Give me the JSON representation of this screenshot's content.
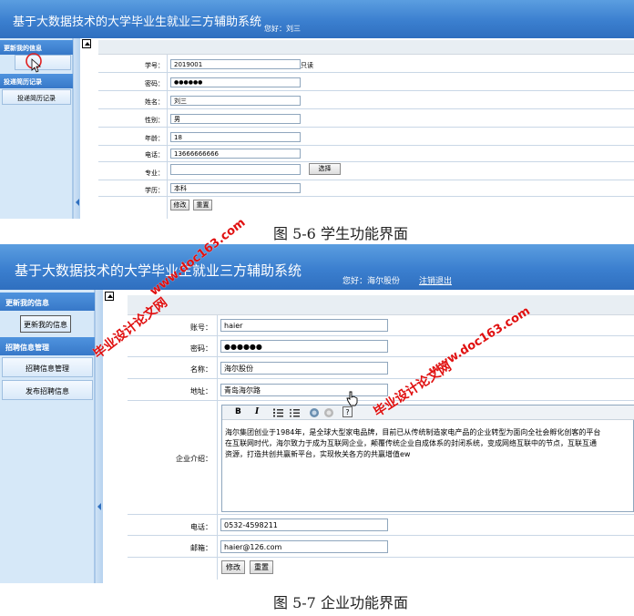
{
  "student": {
    "title": "基于大数据技术的大学毕业生就业三方辅助系统",
    "greeting": "您好：刘三",
    "sidebar": {
      "section1": "更新我的信息",
      "section2": "投递简历记录",
      "item2": "投递简历记录"
    },
    "form": {
      "rows": [
        {
          "label": "学号：",
          "value": "2019001",
          "note": "只读"
        },
        {
          "label": "密码：",
          "value": "●●●●●●"
        },
        {
          "label": "姓名：",
          "value": "刘三"
        },
        {
          "label": "性别：",
          "value": "男"
        },
        {
          "label": "年龄：",
          "value": "18"
        },
        {
          "label": "电话：",
          "value": "13666666666"
        },
        {
          "label": "专业：",
          "value": "",
          "button": "选择"
        },
        {
          "label": "学历：",
          "value": "本科"
        }
      ],
      "submit": "修改",
      "reset": "重置"
    },
    "caption": "图 5-6 学生功能界面"
  },
  "company": {
    "title": "基于大数据技术的大学毕业生就业三方辅助系统",
    "greeting": "您好：海尔股份",
    "logout": "注销退出",
    "sidebar": {
      "section1": "更新我的信息",
      "item1": "更新我的信息",
      "section2": "招聘信息管理",
      "item2": "招聘信息管理",
      "item3": "发布招聘信息"
    },
    "form": {
      "account_label": "账号：",
      "account": "haier",
      "password_label": "密码：",
      "password": "●●●●●●",
      "name_label": "名称：",
      "name": "海尔股份",
      "address_label": "地址：",
      "address": "青岛海尔路",
      "intro_label": "企业介绍：",
      "intro_line1": "海尔集团创业于1984年，是全球大型家电品牌，目前已从传统制造家电产品的企业转型为面向全社会孵化创客的平台",
      "intro_line2": "在互联网时代，海尔致力于成为互联网企业，颠覆传统企业自成体系的封闭系统，变成网络互联中的节点，互联互通",
      "intro_line3": "资源，打造共创共赢新平台，实现攸关各方的共赢增值ew",
      "phone_label": "电话：",
      "phone": "0532-4598211",
      "email_label": "邮箱：",
      "email": "haier@126.com",
      "submit": "修改",
      "reset": "重置"
    },
    "editor_toolbar": {
      "bold": "B",
      "italic": "I",
      "help": "?"
    },
    "caption": "图 5-7 企业功能界面"
  },
  "watermarks": {
    "site": "www.doc163.com",
    "name": "毕业设计论文网"
  }
}
